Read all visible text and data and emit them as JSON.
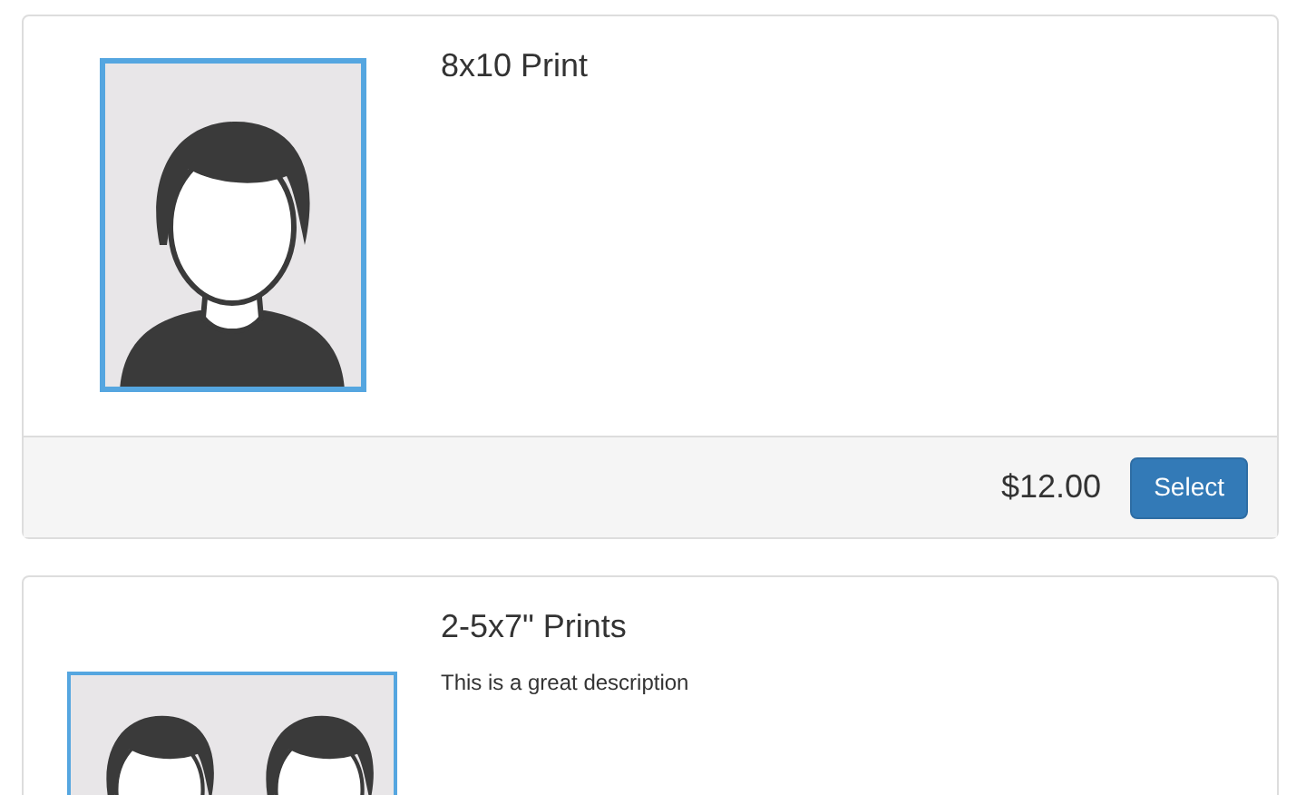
{
  "products": [
    {
      "kind": "single",
      "title": "8x10 Print",
      "price": "$12.00",
      "button": "Select"
    },
    {
      "kind": "double",
      "title": "2-5x7\" Prints",
      "description": "This is a great description"
    }
  ]
}
